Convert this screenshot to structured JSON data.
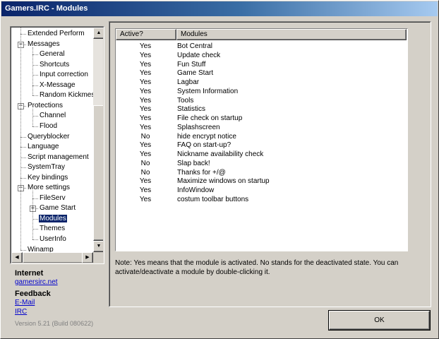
{
  "window": {
    "title": "Gamers.IRC - Modules"
  },
  "tree": {
    "items": [
      {
        "label": "Extended Perform"
      },
      {
        "label": "Messages",
        "expander": "−"
      },
      {
        "label": "General"
      },
      {
        "label": "Shortcuts"
      },
      {
        "label": "Input correction"
      },
      {
        "label": "X-Message"
      },
      {
        "label": "Random Kickmess"
      },
      {
        "label": "Protections",
        "expander": "−"
      },
      {
        "label": "Channel"
      },
      {
        "label": "Flood"
      },
      {
        "label": "Queryblocker"
      },
      {
        "label": "Language"
      },
      {
        "label": "Script management"
      },
      {
        "label": "SystemTray"
      },
      {
        "label": "Key bindings"
      },
      {
        "label": "More settings",
        "expander": "−"
      },
      {
        "label": "FileServ"
      },
      {
        "label": "Game Start",
        "expander": "+"
      },
      {
        "label": "Modules",
        "selected": true
      },
      {
        "label": "Themes"
      },
      {
        "label": "UserInfo"
      },
      {
        "label": "Winamp"
      }
    ],
    "scroll_up": "▲",
    "scroll_down": "▼",
    "scroll_left": "◀",
    "scroll_right": "▶"
  },
  "sidebar_footer": {
    "internet_heading": "Internet",
    "internet_link": "gamersirc.net",
    "feedback_heading": "Feedback",
    "email_link": "E-Mail",
    "irc_link": "IRC",
    "version": "Version 5.21 (Build 080622)"
  },
  "modules": {
    "columns": [
      "Active?",
      "Modules"
    ],
    "rows": [
      {
        "active": "Yes",
        "name": "Bot Central"
      },
      {
        "active": "Yes",
        "name": "Update check"
      },
      {
        "active": "Yes",
        "name": "Fun Stuff"
      },
      {
        "active": "Yes",
        "name": "Game Start"
      },
      {
        "active": "Yes",
        "name": "Lagbar"
      },
      {
        "active": "Yes",
        "name": "System Information"
      },
      {
        "active": "Yes",
        "name": "Tools"
      },
      {
        "active": "Yes",
        "name": "Statistics"
      },
      {
        "active": "Yes",
        "name": "File check on startup"
      },
      {
        "active": "Yes",
        "name": "Splashscreen"
      },
      {
        "active": "No",
        "name": "hide encrypt notice"
      },
      {
        "active": "Yes",
        "name": "FAQ on start-up?"
      },
      {
        "active": "Yes",
        "name": "Nickname availability check"
      },
      {
        "active": "No",
        "name": "Slap back!"
      },
      {
        "active": "No",
        "name": "Thanks for +/@"
      },
      {
        "active": "Yes",
        "name": "Maximize windows on startup"
      },
      {
        "active": "Yes",
        "name": "InfoWindow"
      },
      {
        "active": "Yes",
        "name": "costum toolbar buttons"
      }
    ]
  },
  "note": "Note: Yes means that the module is activated. No stands for the deactivated state. You can activate/deactivate a module by double-clicking it.",
  "ok_label": "OK"
}
